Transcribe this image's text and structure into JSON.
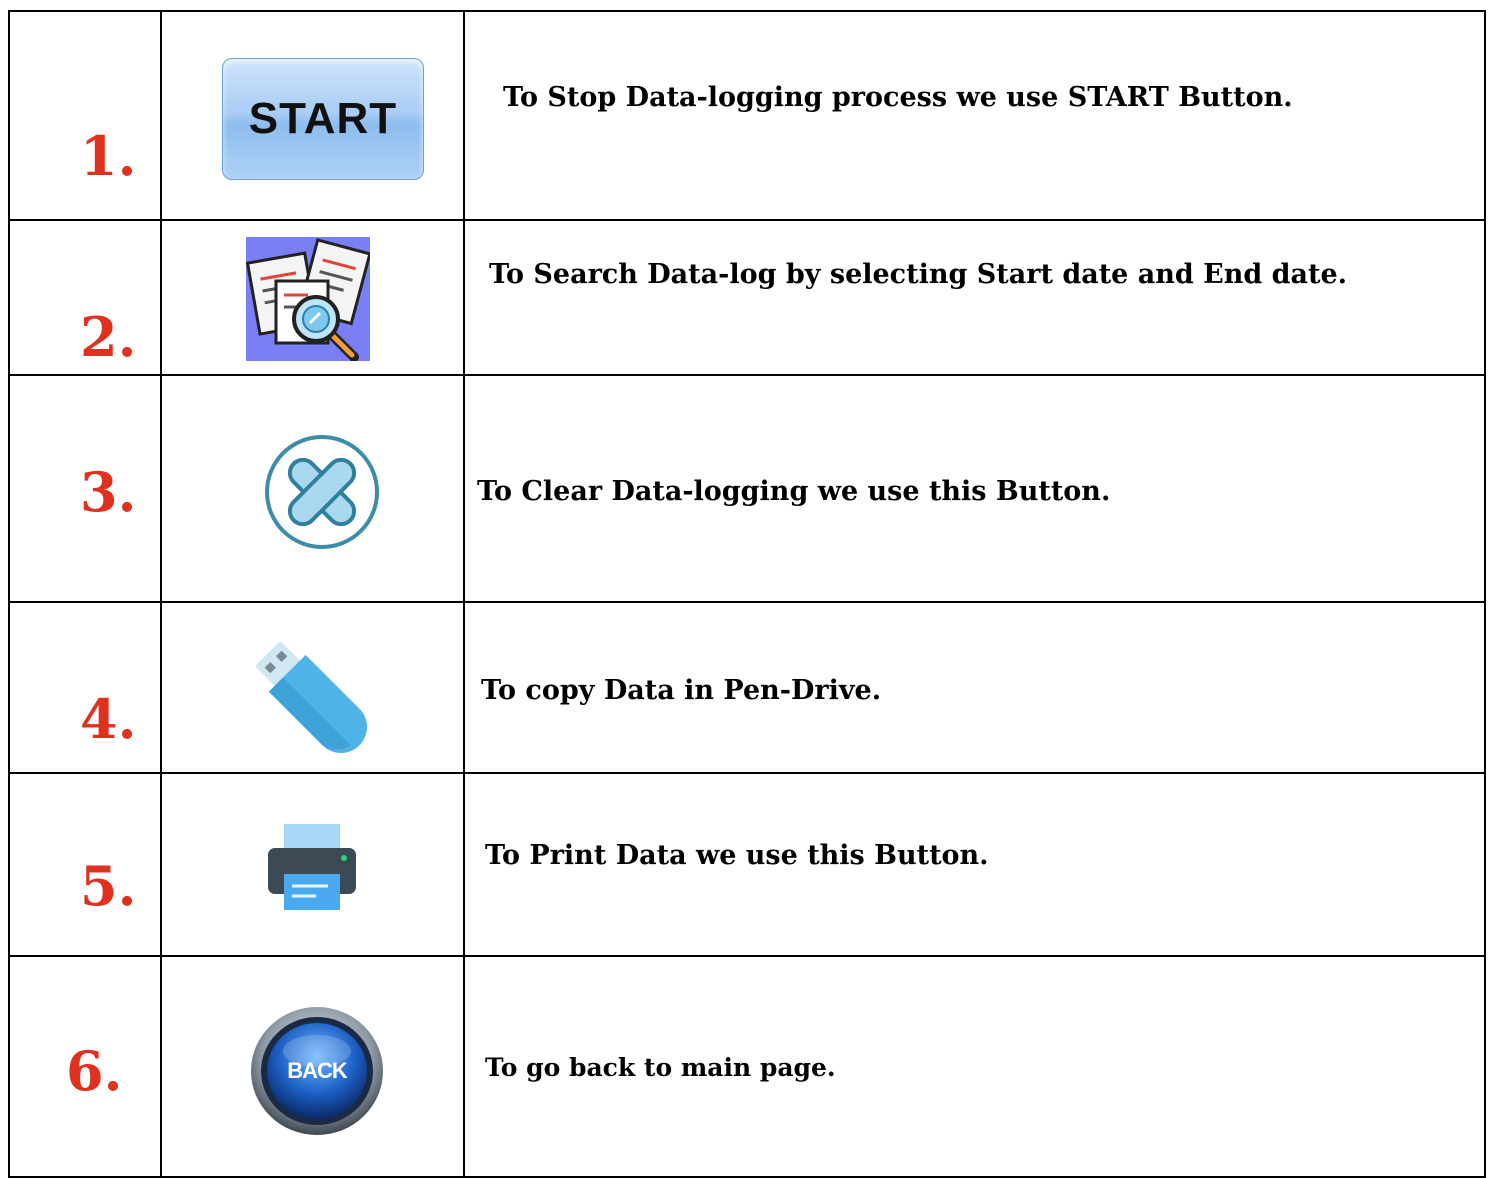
{
  "rows": [
    {
      "number": "1.",
      "icon": "start-button-icon",
      "button_label": "START",
      "description": "To Stop Data-logging process we use START Button."
    },
    {
      "number": "2.",
      "icon": "search-documents-icon",
      "description": "To Search Data-log by selecting Start date and End date."
    },
    {
      "number": "3.",
      "icon": "clear-icon",
      "description": "To Clear Data-logging we use this Button."
    },
    {
      "number": "4.",
      "icon": "usb-drive-icon",
      "description": "To copy Data in Pen-Drive."
    },
    {
      "number": "5.",
      "icon": "printer-icon",
      "description": "To Print Data we use this Button."
    },
    {
      "number": "6.",
      "icon": "back-button-icon",
      "button_label": "BACK",
      "description": "To go back to main page."
    }
  ],
  "colors": {
    "number": "#e0301e",
    "border": "#000000"
  }
}
